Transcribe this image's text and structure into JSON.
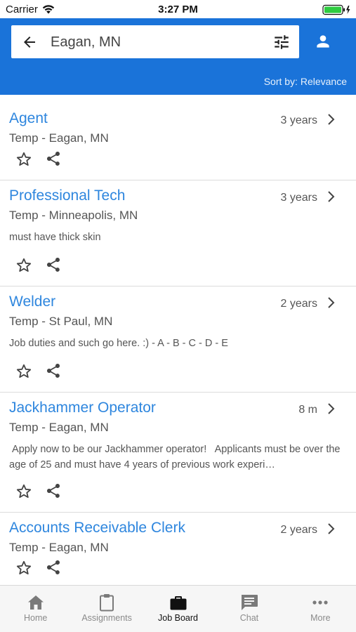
{
  "status_bar": {
    "carrier": "Carrier",
    "time": "3:27 PM"
  },
  "header": {
    "search": {
      "value": "Eagan, MN",
      "placeholder": "Eagan, MN"
    },
    "sort_label": "Sort by: Relevance",
    "accent_color": "#1a73d9"
  },
  "jobs": [
    {
      "title": "Agent",
      "meta": "Temp - Eagan, MN",
      "age": "3 years",
      "description": ""
    },
    {
      "title": "Professional Tech",
      "meta": "Temp - Minneapolis, MN",
      "age": "3 years",
      "description": "must have thick skin"
    },
    {
      "title": "Welder",
      "meta": "Temp - St Paul, MN",
      "age": "2 years",
      "description": "Job duties and such go here. :) - A - B - C - D - E"
    },
    {
      "title": "Jackhammer Operator",
      "meta": "Temp - Eagan, MN",
      "age": "8 m",
      "description": " Apply now to be our Jackhammer operator!   Applicants must be over the age of 25 and must have 4 years of previous work experi…"
    },
    {
      "title": "Accounts Receivable Clerk",
      "meta": "Temp - Eagan, MN",
      "age": "2 years",
      "description": ""
    }
  ],
  "tabs": [
    {
      "label": "Home",
      "icon": "home-icon"
    },
    {
      "label": "Assignments",
      "icon": "clipboard-icon"
    },
    {
      "label": "Job Board",
      "icon": "briefcase-icon",
      "active": true
    },
    {
      "label": "Chat",
      "icon": "chat-icon"
    },
    {
      "label": "More",
      "icon": "more-icon"
    }
  ]
}
